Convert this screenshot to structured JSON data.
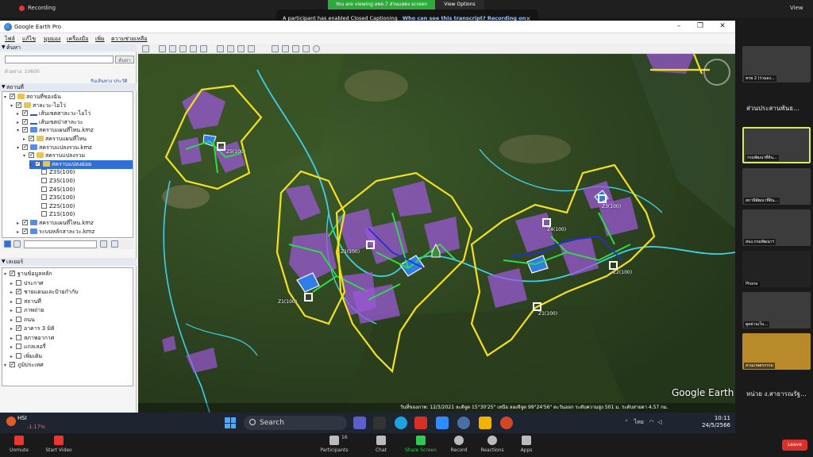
{
  "zoom_top": {
    "recording": "Recording",
    "viewing_banner": "You are viewing ฮพล.7 ส่วนแสดง screen",
    "view_options": "View Options",
    "view": "View",
    "cc_notice": "A participant has enabled Closed Captioning",
    "cc_question": "Who can see this transcript? Recording on"
  },
  "ge": {
    "title": "Google Earth Pro",
    "menu": [
      "ไฟล์",
      "แก้ไข",
      "มุมมอง",
      "เครื่องมือ",
      "เพิ่ม",
      "ความช่วยเหลือ"
    ],
    "search_header": "ค้นหา",
    "search_button": "ค้นหา",
    "search_hint": "ตัวอย่าง: 10600",
    "search_links": "รับเส้นทาง  ประวัติ",
    "places_header": "สถานที่",
    "places": [
      {
        "label": "สถานที่ของฉัน",
        "indent": 0,
        "icon": "folder",
        "checked": true,
        "open": true,
        "selected": false
      },
      {
        "label": "สาละวะ-ไอโว่",
        "indent": 1,
        "icon": "folder",
        "checked": true,
        "open": true,
        "selected": false
      },
      {
        "label": "เส้นเขตสาละวะ-ไอโว่",
        "indent": 2,
        "icon": "path",
        "checked": true,
        "open": false,
        "selected": false
      },
      {
        "label": "เส้นเขตป่าสาละวะ",
        "indent": 2,
        "icon": "path",
        "checked": true,
        "open": false,
        "selected": false
      },
      {
        "label": "สคราบแผนที่ไหน.kmz",
        "indent": 2,
        "icon": "kmz",
        "checked": true,
        "open": true,
        "selected": false
      },
      {
        "label": "สคราบแผนที่ไหน",
        "indent": 3,
        "icon": "folder",
        "checked": true,
        "open": false,
        "selected": false
      },
      {
        "label": "สคราบแปลงรวม.kmz",
        "indent": 2,
        "icon": "kmz",
        "checked": true,
        "open": true,
        "selected": false
      },
      {
        "label": "สคราบแปลงรวม",
        "indent": 3,
        "icon": "folder",
        "checked": true,
        "open": true,
        "selected": false
      },
      {
        "label": "สคราบแปลงย่อย",
        "indent": 4,
        "icon": "folder",
        "checked": true,
        "open": false,
        "selected": true
      },
      {
        "label": "Z3S(100)",
        "indent": 5,
        "icon": "",
        "checked": false,
        "open": false,
        "selected": false
      },
      {
        "label": "Z3S(100)",
        "indent": 5,
        "icon": "",
        "checked": false,
        "open": false,
        "selected": false
      },
      {
        "label": "Z4S(100)",
        "indent": 5,
        "icon": "",
        "checked": false,
        "open": false,
        "selected": false
      },
      {
        "label": "Z3S(100)",
        "indent": 5,
        "icon": "",
        "checked": false,
        "open": false,
        "selected": false
      },
      {
        "label": "Z2S(100)",
        "indent": 5,
        "icon": "",
        "checked": false,
        "open": false,
        "selected": false
      },
      {
        "label": "Z1S(100)",
        "indent": 5,
        "icon": "",
        "checked": false,
        "open": false,
        "selected": false
      },
      {
        "label": "สคราบแผนที่ไหน.kmz",
        "indent": 2,
        "icon": "kmz",
        "checked": true,
        "open": false,
        "selected": false
      },
      {
        "label": "ระบบหลักสาละวะ.kmz",
        "indent": 2,
        "icon": "kmz",
        "checked": true,
        "open": false,
        "selected": false
      }
    ],
    "layers_header": "เลเยอร์",
    "layers": [
      {
        "label": "ฐานข้อมูลหลัก",
        "indent": 0,
        "checked": true
      },
      {
        "label": "ประกาศ",
        "indent": 1,
        "checked": false
      },
      {
        "label": "ชายแดนและป้ายกำกับ",
        "indent": 1,
        "checked": true
      },
      {
        "label": "สถานที่",
        "indent": 1,
        "checked": false
      },
      {
        "label": "ภาพถ่าย",
        "indent": 1,
        "checked": false
      },
      {
        "label": "ถนน",
        "indent": 1,
        "checked": false
      },
      {
        "label": "อาคาร 3 มิติ",
        "indent": 1,
        "checked": true
      },
      {
        "label": "สภาพอากาศ",
        "indent": 1,
        "checked": false
      },
      {
        "label": "แกลเลอรี่",
        "indent": 1,
        "checked": false
      },
      {
        "label": "เพิ่มเติม",
        "indent": 1,
        "checked": false
      },
      {
        "label": "ภูมิประเทศ",
        "indent": 0,
        "checked": true
      }
    ],
    "zones": [
      {
        "label": "Z5(100)"
      },
      {
        "label": "Z4(100)"
      },
      {
        "label": "Z3(100)"
      },
      {
        "label": "Z2(100)"
      },
      {
        "label": "Z1(100)"
      },
      {
        "label": "Z1(100)"
      },
      {
        "label": "Z1(100)"
      }
    ],
    "logo": "Google Earth",
    "status": "วันที่ของภาพ: 12/3/2021   ละติจูด 15°30'25\" เหนือ   ลองจิจูด 99°24'56\" ตะวันออก   ระดับความสูง 501 ม.   ระดับสายตา 4.57 กม."
  },
  "gallery": {
    "tiles": [
      {
        "name": "ทรพ 2 (ร่วมอง...",
        "active": false
      },
      {
        "name": "กรมพัฒนาที่ดิน...",
        "active": true
      },
      {
        "name": "สถานีพัฒนาที่ดิน...",
        "active": false
      },
      {
        "name": "สนง.กรมพัฒนาฯ",
        "active": false
      },
      {
        "name": "Phone",
        "active": false
      },
      {
        "name": "ตูดผ่านเว็บ...",
        "active": false
      },
      {
        "name": "สวนเกษตรกรรม",
        "active": false
      }
    ],
    "captions": [
      "ส่วนประสานพันธ...",
      "หน่วย ง.สาธารณรัฐ..."
    ]
  },
  "taskbar": {
    "weather_label": "HSI",
    "weather_value": "-1.17%",
    "search": "Search",
    "tray": "ไทย",
    "time": "10:11",
    "date": "24/5/2566"
  },
  "zoom_bottom": {
    "unmute": "Unmute",
    "start_video": "Start Video",
    "participants": "Participants",
    "participants_count": "16",
    "chat": "Chat",
    "share_screen": "Share Screen",
    "record": "Record",
    "reactions": "Reactions",
    "apps": "Apps",
    "leave": "Leave"
  },
  "colors": {
    "zone_boundary": "#f4e11d",
    "stream": "#3fd0e8",
    "path": "#2ed94a",
    "parcel": "#9b58d6",
    "pond": "#2f7de8",
    "share_green": "#2dcb52",
    "leave_red": "#d8302a"
  }
}
